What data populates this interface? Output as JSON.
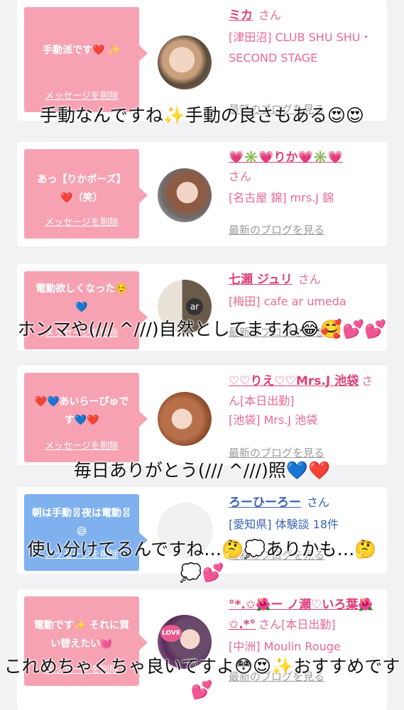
{
  "items": [
    {
      "bubble_msg": "手動派です❤️ ✨",
      "delete_label": "メッセージを削除",
      "name": "ミカ",
      "san": "さん",
      "location": "[津田沼] CLUB SHU SHU・SECOND STAGE",
      "blog_link": "最新のブログを見る"
    },
    {
      "bubble_msg": "あっ【りかポーズ】❤️（笑）",
      "delete_label": "メッセージを削除",
      "name": "💗✳️💗りか💗✳️💗",
      "san": "さん",
      "location": "[名古屋 錦] mrs.J 錦",
      "blog_link": "最新のブログを見る"
    },
    {
      "bubble_msg": "電動欲しくなった☺️💙",
      "delete_label": "メッセージを削除",
      "name": "七瀬 ジュリ",
      "san": "さん",
      "location": "[梅田] cafe ar umeda",
      "blog_link": "最新のブログを見る"
    },
    {
      "bubble_msg": "❤️💙あいらーぴゅです💙❤️",
      "delete_label": "メッセージを削除",
      "name": "♡♡りえ♡♡Mrs.J 池袋",
      "san": "さん[本日出勤]",
      "location": "[池袋] Mrs.J 池袋",
      "blog_link": "最新のブログを見る"
    },
    {
      "bubble_msg": "朝は手動〿夜は電動〿😅",
      "delete_label": "メッセージを削除",
      "name": "ろーひーろー",
      "san": "さん",
      "location": "[愛知県] 体験談 18件",
      "blog_link": "最新のブログを見る"
    },
    {
      "bubble_msg": "電動です✨ それに買い替えたい💓",
      "delete_label": "メッセージを削除",
      "name": "°*.✩🌺ー ノ瀬♡いろ葉🌺✩.*°",
      "san": "さん[本日出勤]",
      "location": "[中洲] Moulin Rouge",
      "blog_link": "最新のブログを見る"
    }
  ],
  "overlays": [
    "手動なんですね✨手動の良さもある😍😍",
    "ホンマや(/// ^///)自然としてますね😂🥰💕💕",
    "毎日ありがとう(/// ^///)照💙❤️",
    "使い分けてるんですね…🤔💭ありかも…🤔💭💕",
    "これめちゃくちゃ良いですよ😳😍✨おすすめです💕"
  ],
  "avatar_badges": {
    "item3": "ar",
    "item6": "LOVE"
  },
  "colors": {
    "bubble_pink": "#f6a2b3",
    "bubble_blue": "#7fb1ee",
    "name_pink": "#e0407a",
    "name_blue": "#3a63b5"
  }
}
